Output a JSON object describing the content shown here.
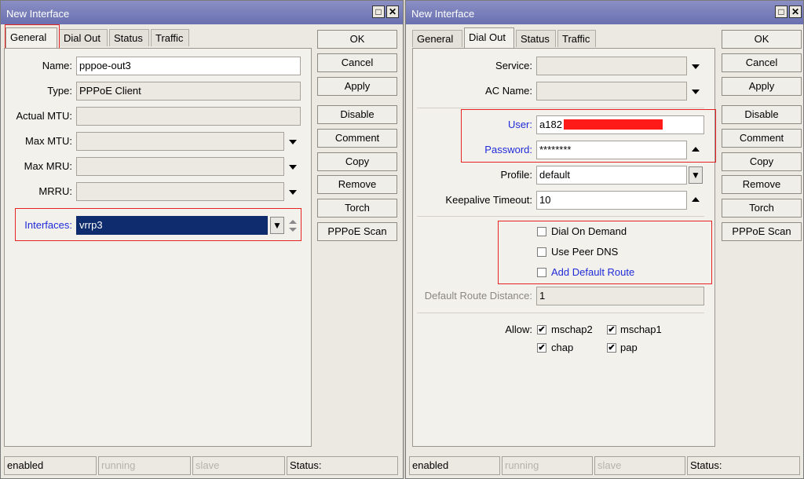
{
  "left_window": {
    "title": "New Interface",
    "tabs": [
      "General",
      "Dial Out",
      "Status",
      "Traffic"
    ],
    "fields": {
      "name_label": "Name:",
      "name_value": "pppoe-out3",
      "type_label": "Type:",
      "type_value": "PPPoE Client",
      "actual_mtu_label": "Actual MTU:",
      "max_mtu_label": "Max MTU:",
      "max_mru_label": "Max MRU:",
      "mrru_label": "MRRU:",
      "interfaces_label": "Interfaces:",
      "interfaces_value": "vrrp3"
    },
    "buttons": [
      "OK",
      "Cancel",
      "Apply",
      "Disable",
      "Comment",
      "Copy",
      "Remove",
      "Torch",
      "PPPoE Scan"
    ],
    "status": [
      "enabled",
      "running",
      "slave",
      "Status:"
    ]
  },
  "right_window": {
    "title": "New Interface",
    "tabs": [
      "General",
      "Dial Out",
      "Status",
      "Traffic"
    ],
    "fields": {
      "service_label": "Service:",
      "ac_name_label": "AC Name:",
      "user_label": "User:",
      "user_value": "a182",
      "password_label": "Password:",
      "password_value": "********",
      "profile_label": "Profile:",
      "profile_value": "default",
      "keepalive_label": "Keepalive Timeout:",
      "keepalive_value": "10",
      "dial_on_demand_label": "Dial On Demand",
      "use_peer_dns_label": "Use Peer DNS",
      "add_default_route_label": "Add Default Route",
      "default_route_distance_label": "Default Route Distance:",
      "default_route_distance_value": "1",
      "allow_label": "Allow:",
      "allow_mschap2": "mschap2",
      "allow_mschap1": "mschap1",
      "allow_chap": "chap",
      "allow_pap": "pap"
    },
    "buttons": [
      "OK",
      "Cancel",
      "Apply",
      "Disable",
      "Comment",
      "Copy",
      "Remove",
      "Torch",
      "PPPoE Scan"
    ],
    "status": [
      "enabled",
      "running",
      "slave",
      "Status:"
    ]
  },
  "icons": {
    "dropdown": "▼",
    "collapse": "▲",
    "check": "✔",
    "maximize": "□",
    "close": "✕"
  },
  "colors": {
    "highlight_red": "#e52323",
    "link_blue": "#1f2bd8",
    "selection_navy": "#0f2d6e",
    "titlebar": "#7478b8"
  }
}
